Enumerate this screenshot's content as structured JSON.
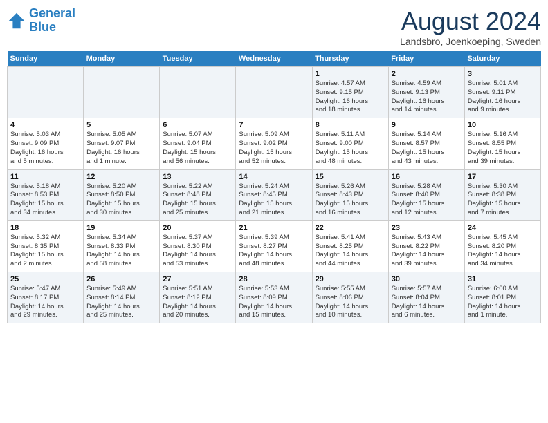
{
  "header": {
    "logo_line1": "General",
    "logo_line2": "Blue",
    "month_title": "August 2024",
    "subtitle": "Landsbro, Joenkoeping, Sweden"
  },
  "days_of_week": [
    "Sunday",
    "Monday",
    "Tuesday",
    "Wednesday",
    "Thursday",
    "Friday",
    "Saturday"
  ],
  "weeks": [
    [
      {
        "day": "",
        "info": ""
      },
      {
        "day": "",
        "info": ""
      },
      {
        "day": "",
        "info": ""
      },
      {
        "day": "",
        "info": ""
      },
      {
        "day": "1",
        "info": "Sunrise: 4:57 AM\nSunset: 9:15 PM\nDaylight: 16 hours\nand 18 minutes."
      },
      {
        "day": "2",
        "info": "Sunrise: 4:59 AM\nSunset: 9:13 PM\nDaylight: 16 hours\nand 14 minutes."
      },
      {
        "day": "3",
        "info": "Sunrise: 5:01 AM\nSunset: 9:11 PM\nDaylight: 16 hours\nand 9 minutes."
      }
    ],
    [
      {
        "day": "4",
        "info": "Sunrise: 5:03 AM\nSunset: 9:09 PM\nDaylight: 16 hours\nand 5 minutes."
      },
      {
        "day": "5",
        "info": "Sunrise: 5:05 AM\nSunset: 9:07 PM\nDaylight: 16 hours\nand 1 minute."
      },
      {
        "day": "6",
        "info": "Sunrise: 5:07 AM\nSunset: 9:04 PM\nDaylight: 15 hours\nand 56 minutes."
      },
      {
        "day": "7",
        "info": "Sunrise: 5:09 AM\nSunset: 9:02 PM\nDaylight: 15 hours\nand 52 minutes."
      },
      {
        "day": "8",
        "info": "Sunrise: 5:11 AM\nSunset: 9:00 PM\nDaylight: 15 hours\nand 48 minutes."
      },
      {
        "day": "9",
        "info": "Sunrise: 5:14 AM\nSunset: 8:57 PM\nDaylight: 15 hours\nand 43 minutes."
      },
      {
        "day": "10",
        "info": "Sunrise: 5:16 AM\nSunset: 8:55 PM\nDaylight: 15 hours\nand 39 minutes."
      }
    ],
    [
      {
        "day": "11",
        "info": "Sunrise: 5:18 AM\nSunset: 8:53 PM\nDaylight: 15 hours\nand 34 minutes."
      },
      {
        "day": "12",
        "info": "Sunrise: 5:20 AM\nSunset: 8:50 PM\nDaylight: 15 hours\nand 30 minutes."
      },
      {
        "day": "13",
        "info": "Sunrise: 5:22 AM\nSunset: 8:48 PM\nDaylight: 15 hours\nand 25 minutes."
      },
      {
        "day": "14",
        "info": "Sunrise: 5:24 AM\nSunset: 8:45 PM\nDaylight: 15 hours\nand 21 minutes."
      },
      {
        "day": "15",
        "info": "Sunrise: 5:26 AM\nSunset: 8:43 PM\nDaylight: 15 hours\nand 16 minutes."
      },
      {
        "day": "16",
        "info": "Sunrise: 5:28 AM\nSunset: 8:40 PM\nDaylight: 15 hours\nand 12 minutes."
      },
      {
        "day": "17",
        "info": "Sunrise: 5:30 AM\nSunset: 8:38 PM\nDaylight: 15 hours\nand 7 minutes."
      }
    ],
    [
      {
        "day": "18",
        "info": "Sunrise: 5:32 AM\nSunset: 8:35 PM\nDaylight: 15 hours\nand 2 minutes."
      },
      {
        "day": "19",
        "info": "Sunrise: 5:34 AM\nSunset: 8:33 PM\nDaylight: 14 hours\nand 58 minutes."
      },
      {
        "day": "20",
        "info": "Sunrise: 5:37 AM\nSunset: 8:30 PM\nDaylight: 14 hours\nand 53 minutes."
      },
      {
        "day": "21",
        "info": "Sunrise: 5:39 AM\nSunset: 8:27 PM\nDaylight: 14 hours\nand 48 minutes."
      },
      {
        "day": "22",
        "info": "Sunrise: 5:41 AM\nSunset: 8:25 PM\nDaylight: 14 hours\nand 44 minutes."
      },
      {
        "day": "23",
        "info": "Sunrise: 5:43 AM\nSunset: 8:22 PM\nDaylight: 14 hours\nand 39 minutes."
      },
      {
        "day": "24",
        "info": "Sunrise: 5:45 AM\nSunset: 8:20 PM\nDaylight: 14 hours\nand 34 minutes."
      }
    ],
    [
      {
        "day": "25",
        "info": "Sunrise: 5:47 AM\nSunset: 8:17 PM\nDaylight: 14 hours\nand 29 minutes."
      },
      {
        "day": "26",
        "info": "Sunrise: 5:49 AM\nSunset: 8:14 PM\nDaylight: 14 hours\nand 25 minutes."
      },
      {
        "day": "27",
        "info": "Sunrise: 5:51 AM\nSunset: 8:12 PM\nDaylight: 14 hours\nand 20 minutes."
      },
      {
        "day": "28",
        "info": "Sunrise: 5:53 AM\nSunset: 8:09 PM\nDaylight: 14 hours\nand 15 minutes."
      },
      {
        "day": "29",
        "info": "Sunrise: 5:55 AM\nSunset: 8:06 PM\nDaylight: 14 hours\nand 10 minutes."
      },
      {
        "day": "30",
        "info": "Sunrise: 5:57 AM\nSunset: 8:04 PM\nDaylight: 14 hours\nand 6 minutes."
      },
      {
        "day": "31",
        "info": "Sunrise: 6:00 AM\nSunset: 8:01 PM\nDaylight: 14 hours\nand 1 minute."
      }
    ]
  ]
}
